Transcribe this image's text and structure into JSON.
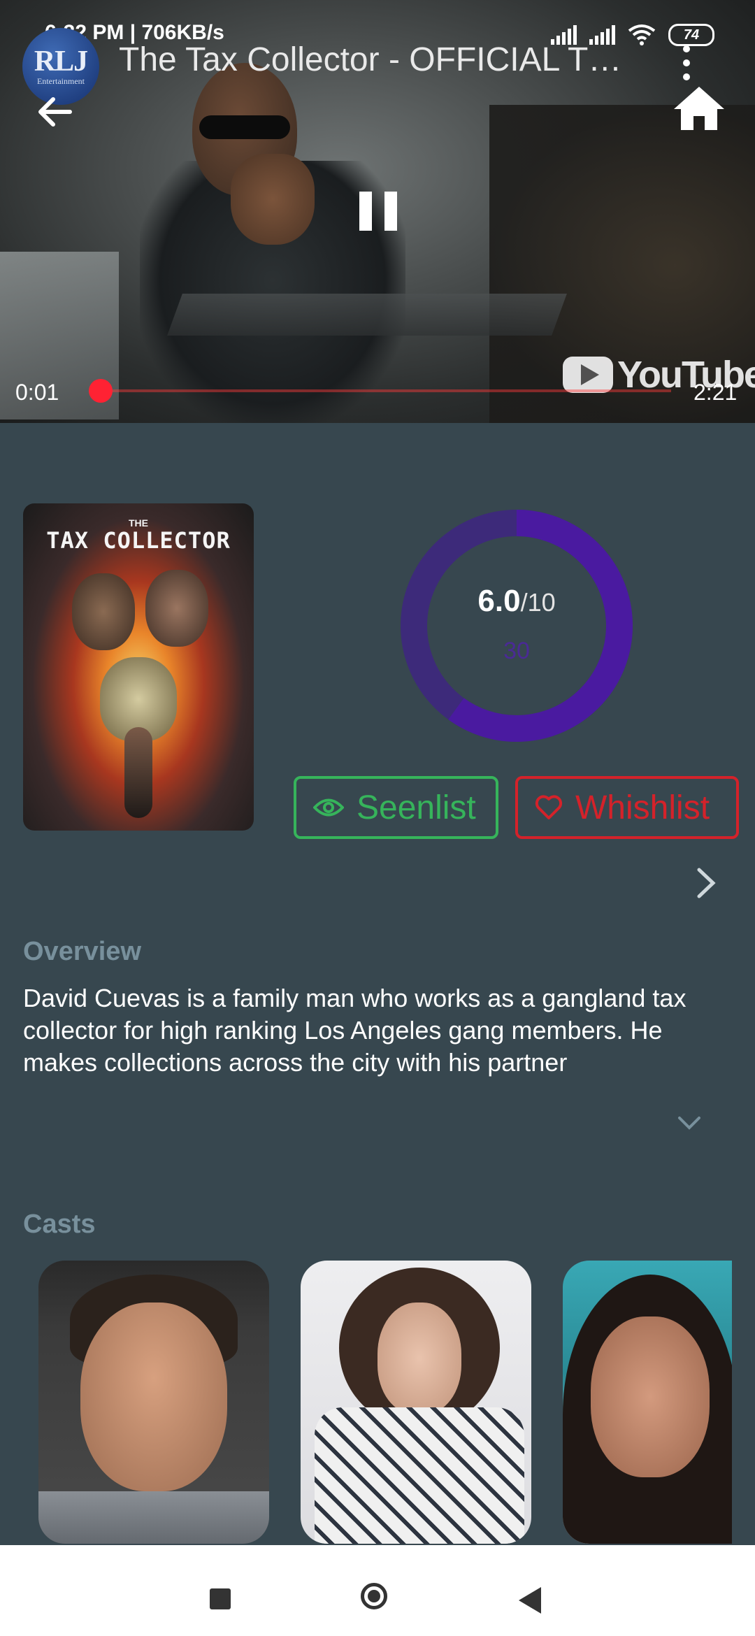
{
  "status_bar": {
    "time": "6:32 PM | 706KB/s",
    "battery": "74"
  },
  "player": {
    "channel_logo_text": "RLJ",
    "channel_logo_subtext": "Entertainment",
    "title": "The Tax Collector - OFFICIAL TR...",
    "current_time": "0:01",
    "total_time": "2:21",
    "progress": 0.007,
    "brand": "YouTube",
    "state": "playing"
  },
  "poster": {
    "title_small": "THE",
    "title": "TAX COLLECTOR"
  },
  "rating": {
    "score": "6.0",
    "max": "/10",
    "votes": "30",
    "fraction": 0.6,
    "color": "#4a1aa0",
    "track_color": "#3d2a7a"
  },
  "actions": {
    "seenlist_label": "Seenlist",
    "wishlist_label": "Whishlist",
    "seen_color": "#36b45b",
    "wish_color": "#d4222a"
  },
  "overview": {
    "heading": "Overview",
    "text": "David Cuevas is a family man who works as a gangland tax collector for high ranking Los Angeles gang members. He makes collections across the city with his partner"
  },
  "casts": {
    "heading": "Casts",
    "count_visible": 3
  },
  "icons": {
    "back": "arrow-left-icon",
    "home": "home-icon",
    "more": "more-vertical-icon",
    "pause": "pause-icon",
    "seen": "eye-icon",
    "wish": "heart-icon",
    "next": "chevron-right-icon",
    "expand": "chevron-down-icon"
  }
}
